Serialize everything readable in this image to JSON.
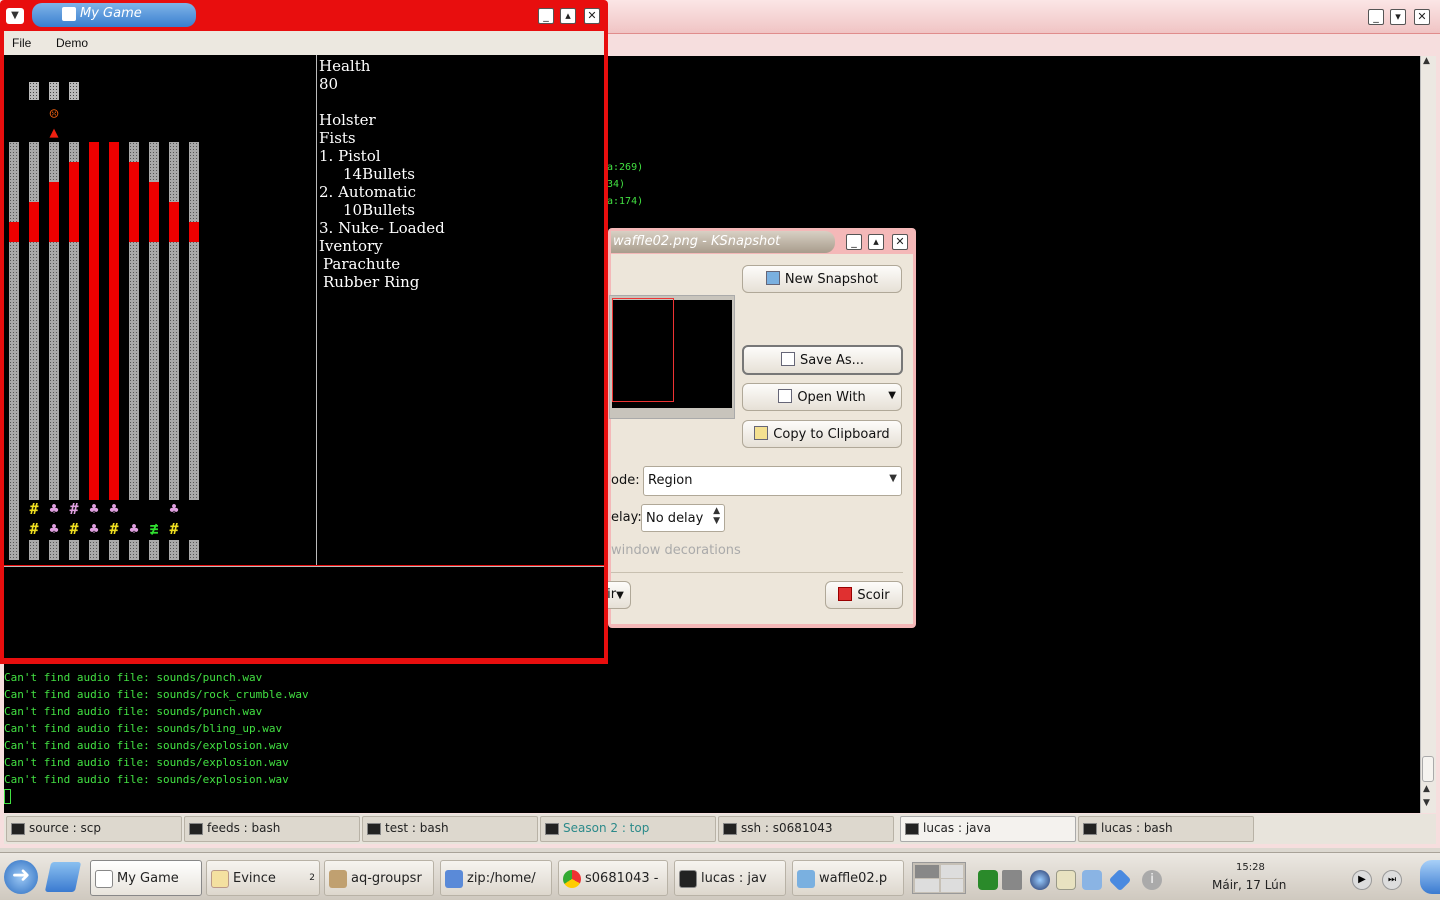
{
  "terminal": {
    "fragments": [
      "a:269)",
      "34)",
      "a:174)"
    ],
    "lines": [
      "Can't find audio file: sounds/punch.wav",
      "Can't find audio file: sounds/rock_crumble.wav",
      "Can't find audio file: sounds/punch.wav",
      "Can't find audio file: sounds/bling_up.wav",
      "Can't find audio file: sounds/explosion.wav",
      "Can't find audio file: sounds/explosion.wav",
      "Can't find audio file: sounds/explosion.wav"
    ],
    "sessions": [
      {
        "label": "source : scp"
      },
      {
        "label": "feeds : bash"
      },
      {
        "label": "test : bash"
      },
      {
        "label": "Season 2 : top"
      },
      {
        "label": "ssh : s0681043"
      },
      {
        "label": "lucas : java"
      },
      {
        "label": "lucas : bash"
      }
    ]
  },
  "game": {
    "title": "My Game",
    "menu": {
      "file": "File",
      "demo": "Demo"
    },
    "stats": {
      "health_label": "Health",
      "health_value": "80",
      "holster_label": "Holster",
      "fists": "Fists",
      "weapon1": "1. Pistol",
      "weapon1_ammo": "14Bullets",
      "weapon2": "2. Automatic",
      "weapon2_ammo": "10Bullets",
      "weapon3": "3. Nuke- Loaded",
      "inventory_label": "Iventory",
      "item1": "Parachute",
      "item2": "Rubber Ring"
    }
  },
  "ksnapshot": {
    "title": "waffle02.png - KSnapshot",
    "new_snapshot": "New Snapshot",
    "save_as": "Save As...",
    "open_with": "Open With",
    "copy_clipboard": "Copy to Clipboard",
    "mode_label": "ode:",
    "mode_value": "Region",
    "delay_label": "elay:",
    "delay_value": "No delay",
    "decorations_label": "window decorations",
    "help_fragment": "ir",
    "quit": "Scoir"
  },
  "taskbar": {
    "tasks": [
      {
        "label": "My Game"
      },
      {
        "label": "Evince"
      },
      {
        "label": "aq-groupsr"
      },
      {
        "label": "zip:/home/"
      },
      {
        "label": "s0681043 -"
      },
      {
        "label": "lucas : jav"
      },
      {
        "label": "waffle02.p"
      }
    ],
    "evince_count": "2",
    "clock_time": "15:28",
    "clock_date": "Máir, 17 Lún"
  }
}
